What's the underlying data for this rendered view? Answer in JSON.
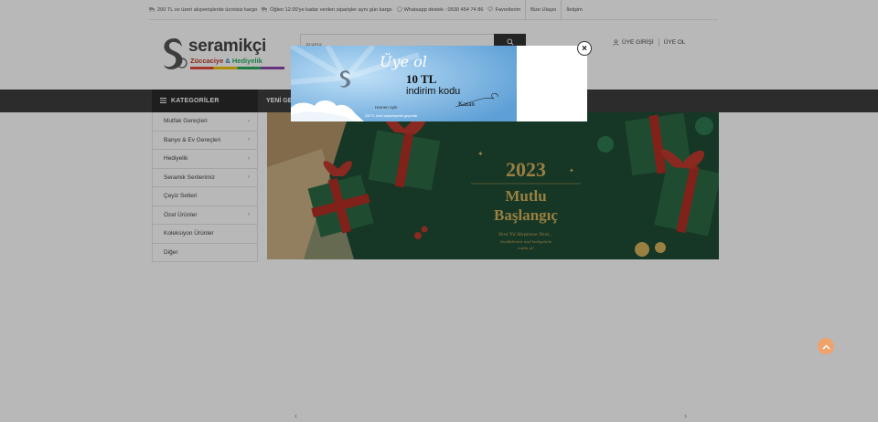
{
  "topbar": {
    "items": [
      {
        "icon": "truck-icon",
        "text": "200 TL ve üzeri alışverişlerde ücretsiz kargo"
      },
      {
        "icon": "truck-icon",
        "text": "Öğlen 12.00'ye kadar verilen siparişler aynı gün kargo"
      },
      {
        "icon": "whatsapp-icon",
        "text": "Whatsapp destek : 0530 454 74 86"
      },
      {
        "icon": "heart-icon",
        "text": "Favorilerim"
      }
    ],
    "links": [
      "Bize Ulaşın",
      "İletişim"
    ]
  },
  "logo": {
    "name": "seramikçi",
    "sub1": "Züccaciye",
    "sub2": "&",
    "sub3": "Hediyelik"
  },
  "search": {
    "placeholder": "Arama",
    "button_icon": "search-icon"
  },
  "account": {
    "login_label": "ÜYE GİRİŞİ",
    "register_label": "ÜYE OL"
  },
  "nav": {
    "categories_label": "KATEGORİLER",
    "link_1": "YENİ GE"
  },
  "sidebar": {
    "items": [
      {
        "label": "Mutfak Gereçleri",
        "has_sub": true
      },
      {
        "label": "Banyo & Ev Gereçleri",
        "has_sub": true
      },
      {
        "label": "Hediyelik",
        "has_sub": true
      },
      {
        "label": "Seramik Serilerimiz",
        "has_sub": true
      },
      {
        "label": "Çeyiz Setleri",
        "has_sub": false
      },
      {
        "label": "Özel Ürünler",
        "has_sub": true
      },
      {
        "label": "Koleksiyon Ürünler",
        "has_sub": false
      },
      {
        "label": "Diğer",
        "has_sub": false
      }
    ],
    "chevron": "›"
  },
  "banner": {
    "year": "2023",
    "line1": "Mutlu",
    "line2": "Başlangıç",
    "tagline": "Yeni Yıl Hepinize Yeni...",
    "tagline2": "Yenilikleriniz özel hediyelerle",
    "tagline3": "mutlu et!",
    "colors": {
      "background": "#1f4b35",
      "ribbon": "#c0392b",
      "gold": "#d4b25a"
    }
  },
  "popup": {
    "title": "Üye ol",
    "amount": "10 TL",
    "code_text": "indirim kodu",
    "kazan": "Kazan",
    "hemen": "Hemen üyle",
    "fine_print": "200 TL üzeri alışverişlerde geçerlidir",
    "close_label": "×",
    "colors": {
      "sky": "#6fa8dc",
      "cloud": "#ffffff"
    }
  },
  "scroll_top_icon": "chevron-up-icon",
  "slider": {
    "prev": "‹",
    "next": "›"
  }
}
